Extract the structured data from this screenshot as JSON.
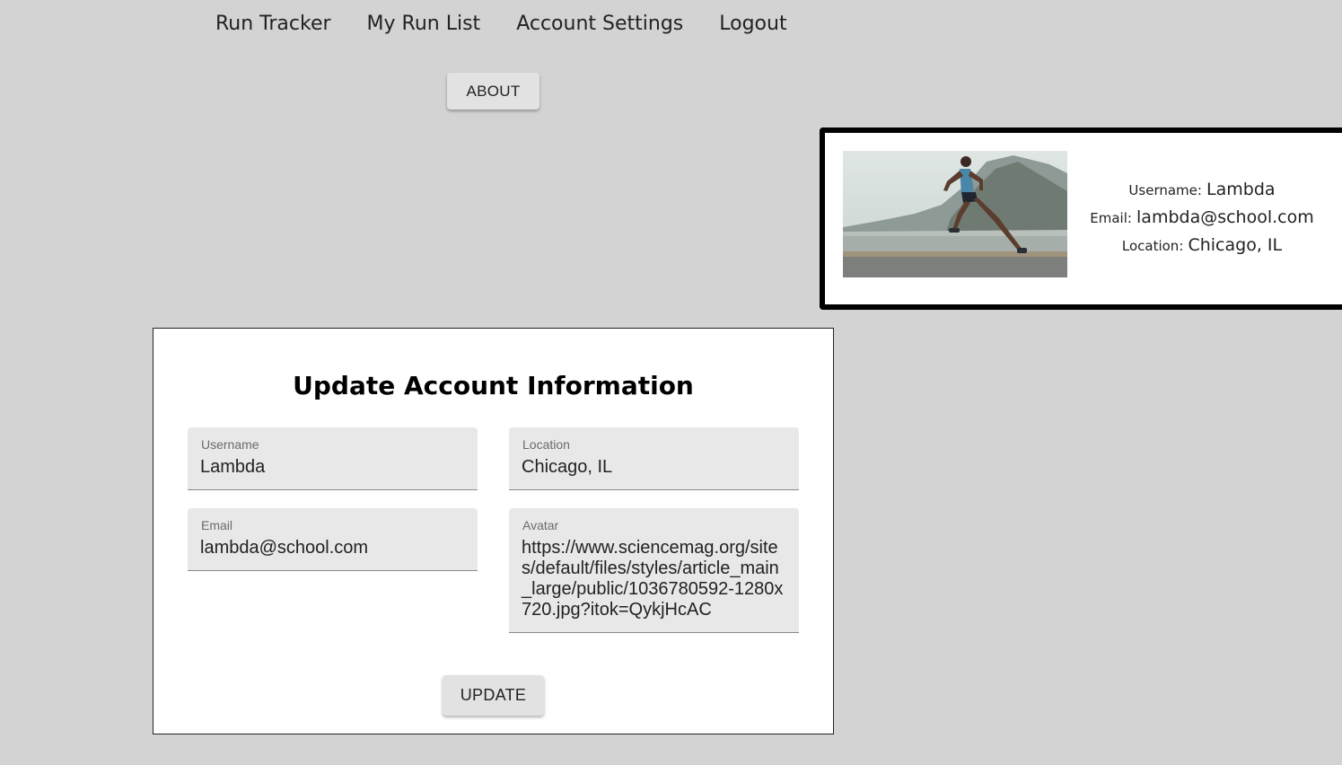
{
  "nav": {
    "items": [
      {
        "label": "Run Tracker"
      },
      {
        "label": "My Run List"
      },
      {
        "label": "Account Settings"
      },
      {
        "label": "Logout"
      }
    ]
  },
  "about_button": {
    "label": "ABOUT"
  },
  "profile": {
    "image_icon": "runner-photo",
    "username_label": "Username:",
    "username": "Lambda",
    "email_label": "Email:",
    "email": "lambda@school.com",
    "location_label": "Location:",
    "location": "Chicago, IL"
  },
  "form": {
    "title": "Update Account Information",
    "username": {
      "label": "Username",
      "value": "Lambda"
    },
    "location": {
      "label": "Location",
      "value": "Chicago, IL"
    },
    "email": {
      "label": "Email",
      "value": "lambda@school.com"
    },
    "avatar": {
      "label": "Avatar",
      "value": "https://www.sciencemag.org/sites/default/files/styles/article_main_large/public/1036780592-1280x720.jpg?itok=QykjHcAC"
    },
    "update_label": "UPDATE"
  }
}
